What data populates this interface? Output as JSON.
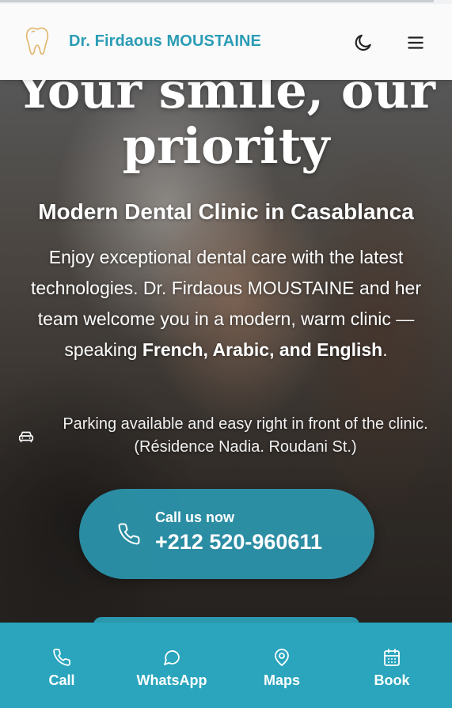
{
  "header": {
    "brand": "Dr. Firdaous MOUSTAINE",
    "logo_icon": "tooth-icon",
    "theme_icon": "moon-icon",
    "menu_icon": "hamburger-menu-icon"
  },
  "hero": {
    "headline": "Your smile, our priority",
    "subtitle": "Modern Dental Clinic in Casablanca",
    "intro_start": "Enjoy exceptional dental care with the latest technologies. Dr. Firdaous MOUSTAINE and her team welcome you in a modern, warm clinic — speaking ",
    "intro_languages": "French, Arabic, and English",
    "intro_end": ".",
    "parking_icon": "car-icon",
    "parking_text": "Parking available and easy right in front of the clinic. (Résidence Nadia. Roudani St.)"
  },
  "call": {
    "label": "Call us now",
    "number": "+212 520-960611",
    "icon": "phone-icon"
  },
  "bottom_nav": {
    "items": [
      {
        "label": "Call",
        "icon": "phone-icon"
      },
      {
        "label": "WhatsApp",
        "icon": "chat-bubble-icon"
      },
      {
        "label": "Maps",
        "icon": "map-pin-icon"
      },
      {
        "label": "Book",
        "icon": "calendar-icon"
      }
    ]
  },
  "colors": {
    "accent": "#2b9cb5",
    "nav_background": "#2aa5bd",
    "logo_stroke": "#e0b56a"
  }
}
